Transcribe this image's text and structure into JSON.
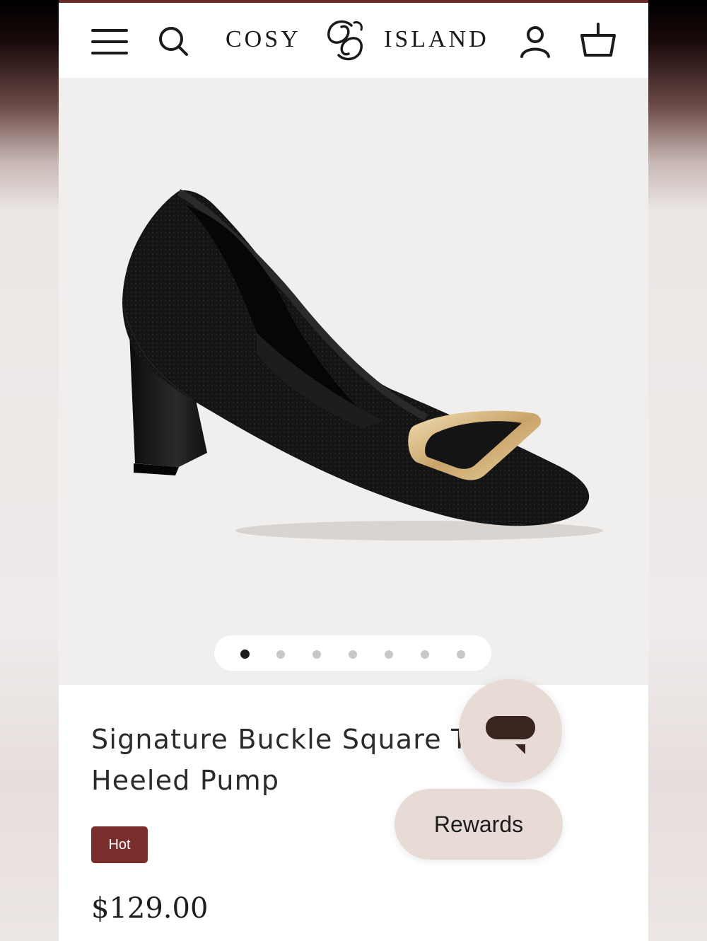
{
  "header": {
    "brand_left": "COSY",
    "brand_right": "ISLAND",
    "icons": {
      "menu": "hamburger-menu-icon",
      "search": "search-icon",
      "account": "user-account-icon",
      "cart": "shopping-basket-icon"
    }
  },
  "gallery": {
    "image": "black knit square-toe heeled pump with gold buckle",
    "image_count": 7,
    "active_index": 0
  },
  "product": {
    "title": "Signature Buckle Square Toe Heeled Pump",
    "badge": "Hot",
    "price": "$129.00"
  },
  "floating": {
    "chat_icon": "chat-bubble-icon",
    "rewards_label": "Rewards"
  },
  "colors": {
    "accent": "#7a2e2c",
    "floating_bg": "#e8dbd5",
    "gallery_bg": "#f1efed",
    "active_dot": "#1b1b1b",
    "inactive_dot": "#c8c8c8"
  }
}
